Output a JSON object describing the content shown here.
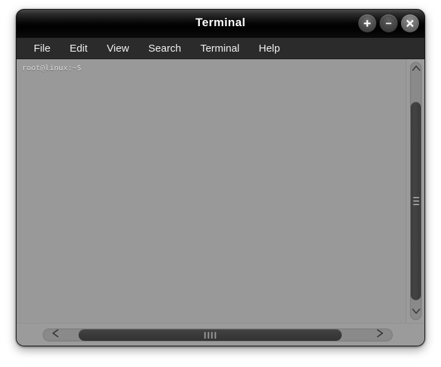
{
  "window": {
    "title": "Terminal",
    "controls": [
      {
        "name": "maximize",
        "icon": "plus-icon",
        "glyph": "+"
      },
      {
        "name": "minimize",
        "icon": "minus-icon",
        "glyph": "−"
      },
      {
        "name": "close",
        "icon": "close-icon",
        "glyph": "×"
      }
    ]
  },
  "menubar": {
    "items": [
      {
        "label": "File"
      },
      {
        "label": "Edit"
      },
      {
        "label": "View"
      },
      {
        "label": "Search"
      },
      {
        "label": "Terminal"
      },
      {
        "label": "Help"
      }
    ]
  },
  "terminal": {
    "background_color": "#999999",
    "text_color": "#d8d8d8",
    "lines": [
      "root@linux:~$"
    ],
    "prompt_user": "root",
    "prompt_host": "linux",
    "prompt_path": "~",
    "prompt_symbol": "$"
  },
  "scrollbars": {
    "vertical": {
      "up_arrow_icon": "chevron-up-icon",
      "down_arrow_icon": "chevron-down-icon",
      "thumb_grip_lines": 3
    },
    "horizontal": {
      "left_arrow_icon": "chevron-left-icon",
      "right_arrow_icon": "chevron-right-icon",
      "thumb_grip_lines": 4
    }
  },
  "colors": {
    "titlebar": "#000000",
    "menubar": "#2b2b2b",
    "terminal_bg": "#999999",
    "scrollbar_track": "#8a8a8a",
    "scrollbar_thumb": "#3c3c3c",
    "page_bg": "#ffffff"
  }
}
